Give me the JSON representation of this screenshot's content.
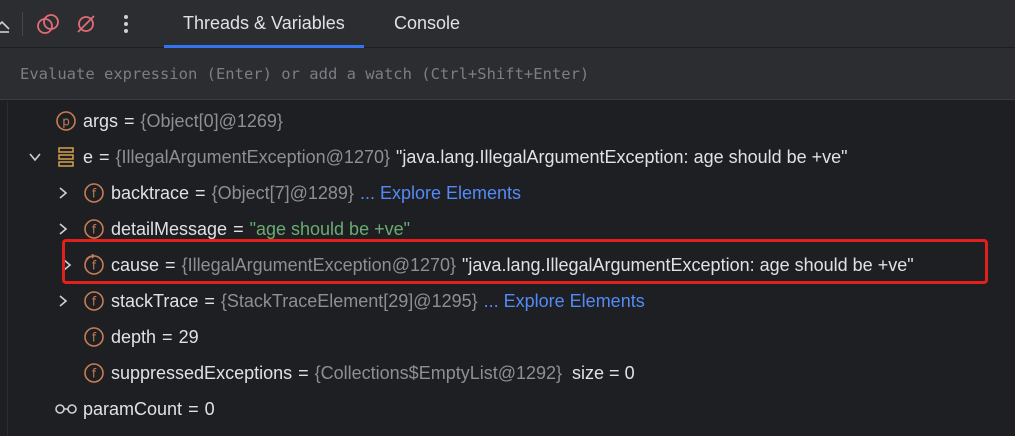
{
  "toolbar": {
    "icons": [
      "collapse-icon",
      "view-breakpoints-icon",
      "mute-breakpoints-icon",
      "more-options-icon"
    ],
    "tabs": [
      {
        "label": "Threads & Variables",
        "active": true
      },
      {
        "label": "Console",
        "active": false
      }
    ]
  },
  "evaluate": {
    "placeholder": "Evaluate expression (Enter) or add a watch (Ctrl+Shift+Enter)"
  },
  "variables": [
    {
      "name": "args",
      "eq": "=",
      "ref": "{Object[0]@1269}",
      "icon": "parameter-icon"
    },
    {
      "name": "e",
      "eq": "=",
      "ref": "{IllegalArgumentException@1270}",
      "value": "\"java.lang.IllegalArgumentException: age should be +ve\"",
      "icon": "object-icon",
      "expanded": true
    },
    {
      "name": "backtrace",
      "eq": "=",
      "ref": "{Object[7]@1289}",
      "link": "... Explore Elements",
      "icon": "field-icon"
    },
    {
      "name": "detailMessage",
      "eq": "=",
      "value": "\"age should be +ve\"",
      "icon": "field-icon"
    },
    {
      "name": "cause",
      "eq": "=",
      "ref": "{IllegalArgumentException@1270}",
      "value": "\"java.lang.IllegalArgumentException: age should be +ve\"",
      "icon": "recursive-field-icon",
      "highlighted": true
    },
    {
      "name": "stackTrace",
      "eq": "=",
      "ref": "{StackTraceElement[29]@1295}",
      "link": "... Explore Elements",
      "icon": "field-icon"
    },
    {
      "name": "depth",
      "eq": "=",
      "value": "29",
      "icon": "field-icon"
    },
    {
      "name": "suppressedExceptions",
      "eq": "=",
      "ref": "{Collections$EmptyList@1292}",
      "extra": "size = 0",
      "icon": "field-icon"
    },
    {
      "name": "paramCount",
      "eq": "=",
      "value": "0",
      "icon": "watch-glasses-icon"
    }
  ],
  "colors": {
    "accent": "#3574f0",
    "field_icon": "#c77d55",
    "string": "#6aab73",
    "link": "#548af7",
    "highlight_border": "#e0201b"
  }
}
